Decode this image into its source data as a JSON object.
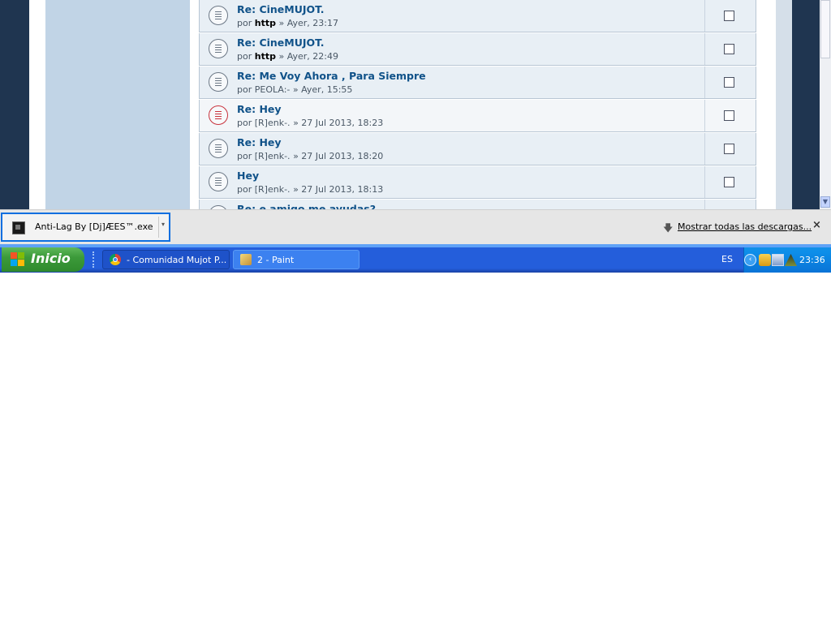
{
  "forum": {
    "posts": [
      {
        "title": "Re: CineMUJOT.",
        "author": "http",
        "author_bold": true,
        "date": "Ayer, 23:17",
        "hot": false
      },
      {
        "title": "Re: CineMUJOT.",
        "author": "http",
        "author_bold": true,
        "date": "Ayer, 22:49",
        "hot": false
      },
      {
        "title": "Re: Me Voy Ahora , Para Siempre",
        "author": "PEOLA:-",
        "author_bold": false,
        "date": "Ayer, 15:55",
        "hot": false
      },
      {
        "title": "Re: Hey",
        "author": "[R]enk-.",
        "author_bold": false,
        "date": "27 Jul 2013, 18:23",
        "hot": true
      },
      {
        "title": "Re: Hey",
        "author": "[R]enk-.",
        "author_bold": false,
        "date": "27 Jul 2013, 18:20",
        "hot": false
      },
      {
        "title": "Hey",
        "author": "[R]enk-.",
        "author_bold": false,
        "date": "27 Jul 2013, 18:13",
        "hot": false
      },
      {
        "title": "Re: e amigo me ayudas?",
        "author": "",
        "author_bold": false,
        "date": "",
        "hot": false
      }
    ],
    "by_word": "por",
    "sep": "»"
  },
  "download_bar": {
    "file_name": "Anti-Lag By [Dj]ÆES™.exe",
    "show_all": "Mostrar todas las descargas...",
    "close": "×",
    "caret": "▾",
    "arrow": "🡇"
  },
  "taskbar": {
    "start_label": "Inicio",
    "tasks": [
      {
        "label": "- Comunidad Mujot P...",
        "icon": "chrome-icon"
      },
      {
        "label": "2 - Paint",
        "icon": "paint-icon"
      }
    ],
    "language": "ES",
    "clock": "23:36",
    "tray_expand": "‹"
  },
  "scroll": {
    "down_glyph": "▼"
  },
  "colors": {
    "page_bg": "#1f3550",
    "sidebar": "#c1d4e6",
    "link": "#105289",
    "accent_blue": "#0c6fe0",
    "taskbar": "#245edb",
    "start_green": "#3c9a3a"
  }
}
